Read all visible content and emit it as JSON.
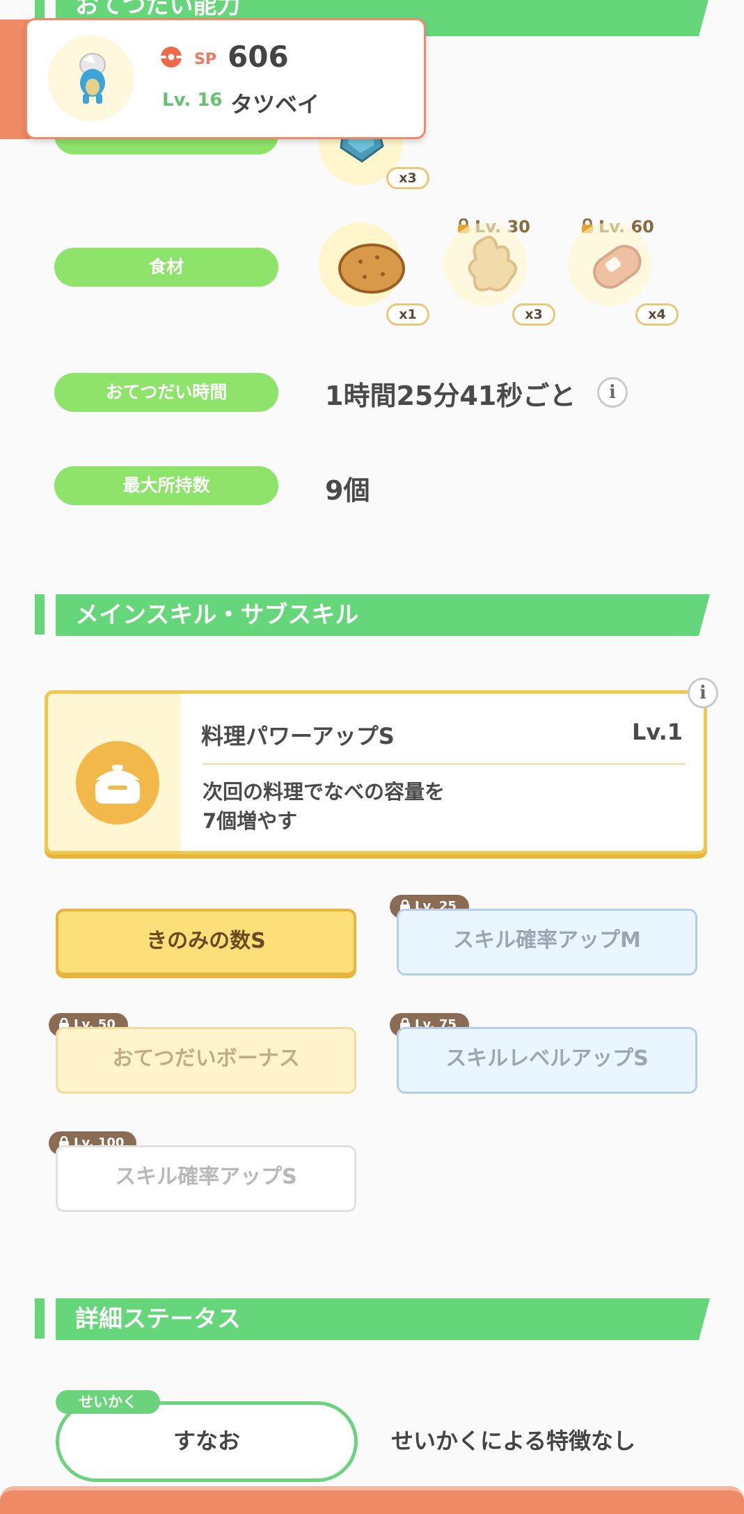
{
  "header_card": {
    "sp_label": "SP",
    "sp_value": "606",
    "level_label": "Lv. 16",
    "pokemon_name": "タツベイ"
  },
  "sections": {
    "help_ability": "おてつだい能力",
    "main_sub_skill": "メインスキル・サブスキル",
    "detail_status": "詳細ステータス"
  },
  "berry_row": {
    "qty": "x3"
  },
  "ingredients": {
    "label": "食材",
    "items": [
      {
        "name": "potato-icon",
        "qty": "x1",
        "lock": ""
      },
      {
        "name": "ginger-icon",
        "qty": "x3",
        "lock": "Lv. 30"
      },
      {
        "name": "sausage-icon",
        "qty": "x4",
        "lock": "Lv. 60"
      }
    ]
  },
  "help_time": {
    "label": "おてつだい時間",
    "value": "1時間25分41秒ごと"
  },
  "max_carry": {
    "label": "最大所持数",
    "value": "9個"
  },
  "main_skill": {
    "name": "料理パワーアップS",
    "level": "Lv.1",
    "desc_line1": "次回の料理でなべの容量を",
    "desc_line2": "7個増やす"
  },
  "sub_skills": [
    {
      "label": "きのみの数S",
      "lock": ""
    },
    {
      "label": "スキル確率アップM",
      "lock": "Lv. 25"
    },
    {
      "label": "おてつだいボーナス",
      "lock": "Lv. 50"
    },
    {
      "label": "スキルレベルアップS",
      "lock": "Lv. 75"
    },
    {
      "label": "スキル確率アップS",
      "lock": "Lv. 100"
    }
  ],
  "nature": {
    "tag": "せいかく",
    "value": "すなお",
    "effect": "せいかくによる特徴なし"
  },
  "info_glyph": "i",
  "colors": {
    "green": "#66d67a",
    "pill_green": "#8ee36a",
    "gold": "#f0c850",
    "orange": "#ef8a66"
  }
}
